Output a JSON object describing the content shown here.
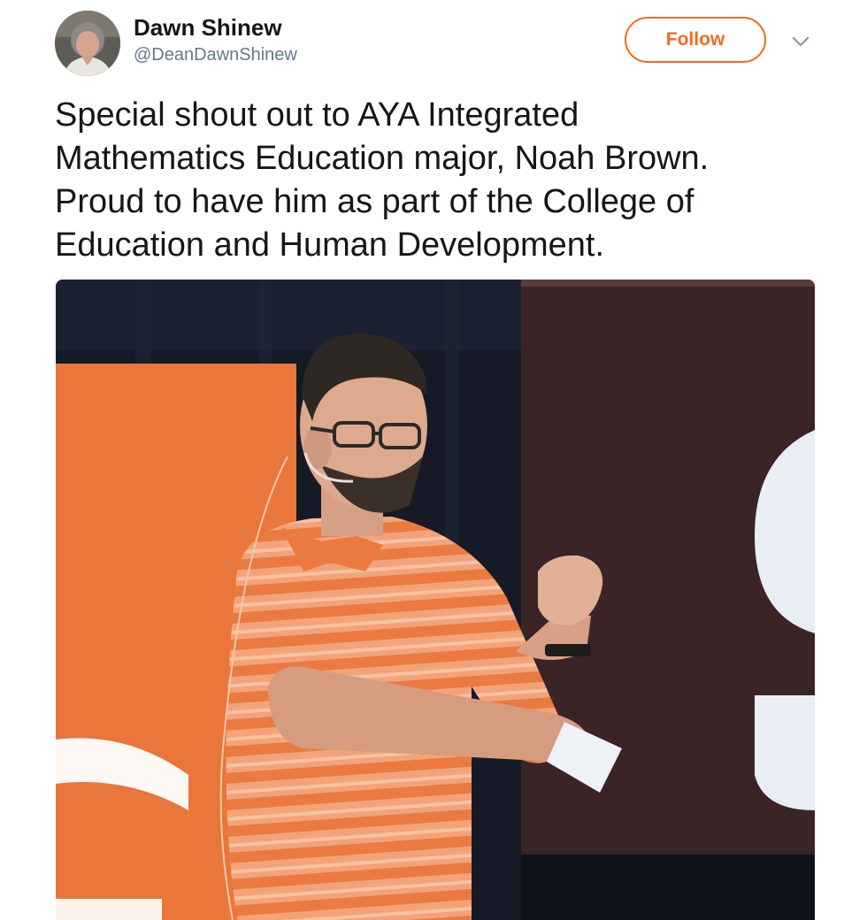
{
  "tweet": {
    "author": {
      "name": "Dawn Shinew",
      "handle": "@DeanDawnShinew",
      "avatar_icon": "profile-photo"
    },
    "follow_label": "Follow",
    "menu_icon": "chevron-down-icon",
    "text_lines": [
      "Special shout out to AYA Integrated",
      "Mathematics Education major, Noah Brown.",
      "Proud to have him as part of the College of",
      "Education and Human Development."
    ],
    "media": {
      "kind": "photo",
      "subject": "presenter-on-stage"
    }
  },
  "colors": {
    "accent": "#f26b21",
    "text_primary": "#14171a",
    "text_secondary": "#657786",
    "banner_orange": "#e9763a",
    "screen_brown": "#3a2426"
  }
}
